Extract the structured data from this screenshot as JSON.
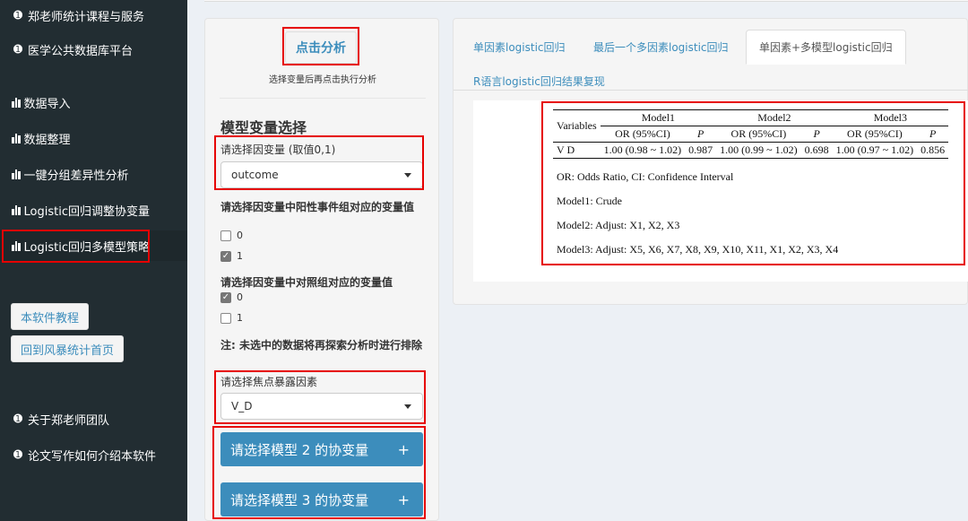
{
  "sidebar": {
    "top_items": [
      {
        "label": "郑老师统计课程与服务",
        "icon": "circle-info-icon"
      },
      {
        "label": "医学公共数据库平台",
        "icon": "circle-info-icon"
      }
    ],
    "menu_items": [
      {
        "label": "数据导入",
        "icon": "bar-chart-icon"
      },
      {
        "label": "数据整理",
        "icon": "bar-chart-icon"
      },
      {
        "label": "一键分组差异性分析",
        "icon": "bar-chart-icon"
      },
      {
        "label": "Logistic回归调整协变量",
        "icon": "bar-chart-icon"
      },
      {
        "label": "Logistic回归多模型策略",
        "icon": "bar-chart-icon",
        "active": true
      }
    ],
    "buttons": [
      "本软件教程",
      "回到风暴统计首页"
    ],
    "bottom_items": [
      {
        "label": "关于郑老师团队",
        "icon": "circle-info-icon"
      },
      {
        "label": "论文写作如何介绍本软件",
        "icon": "circle-info-icon"
      }
    ]
  },
  "left_panel": {
    "run_button": "点击分析",
    "run_hint": "选择变量后再点击执行分析",
    "section_title": "模型变量选择",
    "outcome_label": "请选择因变量 (取值0,1)",
    "outcome_value": "outcome",
    "positive_label": "请选择因变量中阳性事件组对应的变量值",
    "positive_options": [
      {
        "label": "0",
        "checked": false
      },
      {
        "label": "1",
        "checked": true
      }
    ],
    "control_label": "请选择因变量中对照组对应的变量值",
    "control_options": [
      {
        "label": "0",
        "checked": true
      },
      {
        "label": "1",
        "checked": false
      }
    ],
    "note": "注: 未选中的数据将再探索分析时进行排除",
    "exposure_label": "请选择焦点暴露因素",
    "exposure_value": "V_D",
    "model2_button": "请选择模型 2 的协变量",
    "model3_button": "请选择模型 3 的协变量",
    "collapse_symbol": "+"
  },
  "tabs": [
    {
      "label": "单因素logistic回归",
      "active": false
    },
    {
      "label": "最后一个多因素logistic回归",
      "active": false
    },
    {
      "label": "单因素+多模型logistic回归",
      "active": true
    },
    {
      "label": "R语言logistic回归结果复现",
      "active": false
    }
  ],
  "result_table": {
    "variables_header": "Variables",
    "models": [
      "Model1",
      "Model2",
      "Model3"
    ],
    "sub_headers": [
      "OR (95%CI)",
      "P"
    ],
    "rows": [
      {
        "variable": "V D",
        "values": [
          "1.00 (0.98 ~ 1.02)",
          "0.987",
          "1.00 (0.99 ~ 1.02)",
          "0.698",
          "1.00 (0.97 ~ 1.02)",
          "0.856"
        ]
      }
    ],
    "notes": [
      "OR: Odds Ratio, CI: Confidence Interval",
      "Model1: Crude",
      "Model2: Adjust: X1, X2, X3",
      "Model3: Adjust: X5, X6, X7, X8, X9, X10, X11, X1, X2, X3, X4"
    ]
  },
  "colors": {
    "sidebar_bg": "#222d32",
    "accent": "#3c8dbc",
    "highlight": "#e60000"
  }
}
